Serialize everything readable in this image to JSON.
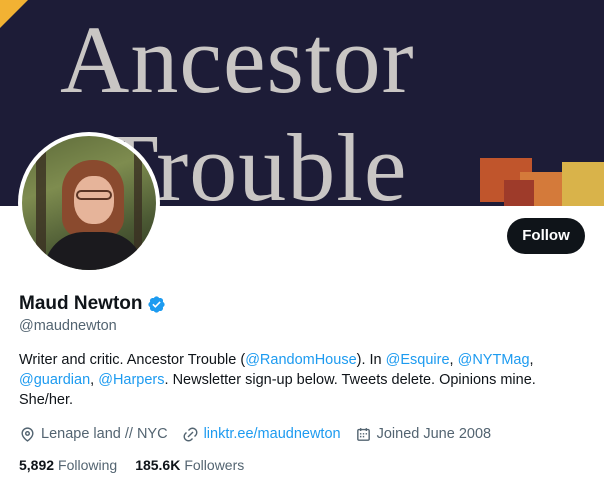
{
  "banner": {
    "line1": "Ancestor",
    "line2": "Trouble"
  },
  "profile": {
    "display_name": "Maud Newton",
    "handle": "@maudnewton",
    "follow_label": "Follow",
    "bio": {
      "t1": "Writer and critic. Ancestor Trouble (",
      "m1": "@RandomHouse",
      "t2": "). In ",
      "m2": "@Esquire",
      "t3": ", ",
      "m3": "@NYTMag",
      "t4": ",",
      "m4": "@guardian",
      "t5": ", ",
      "m5": "@Harpers",
      "t6": ". Newsletter sign-up below. Tweets delete. Opinions mine. She/her."
    },
    "location": "Lenape land // NYC",
    "website": "linktr.ee/maudnewton",
    "joined": "Joined June 2008",
    "following_count": "5,892",
    "following_label": "Following",
    "followers_count": "185.6K",
    "followers_label": "Followers"
  },
  "icons": {
    "verified": "verified-badge-icon",
    "location": "location-pin-icon",
    "link": "link-icon",
    "calendar": "calendar-icon"
  },
  "colors": {
    "accent": "#1d9bf0",
    "text": "#0f1419",
    "secondary": "#536471",
    "button_bg": "#0f1419",
    "banner_bg": "#1d1c37"
  }
}
